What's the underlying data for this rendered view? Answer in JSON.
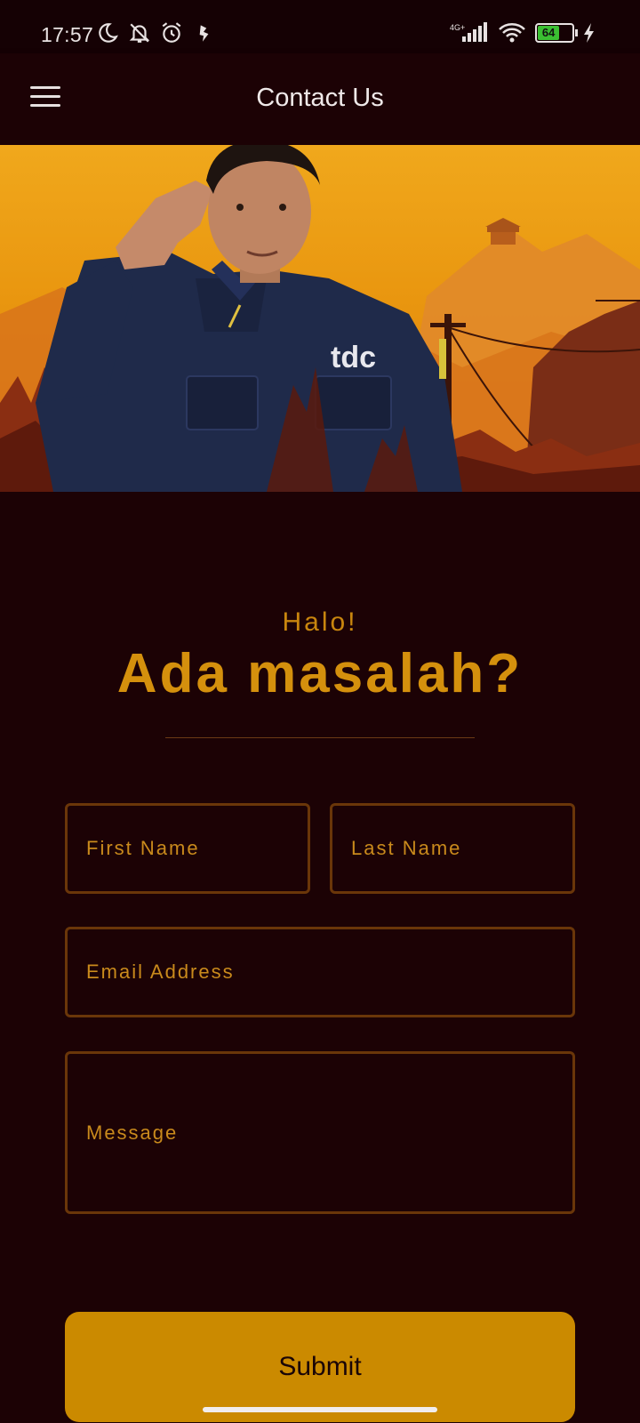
{
  "status_bar": {
    "time": "17:57",
    "network": "4G+",
    "battery_level": "64",
    "battery_color": "#3bbf32"
  },
  "app_bar": {
    "title": "Contact Us",
    "menu_icon": "hamburger-menu-icon"
  },
  "hero": {
    "shirt_logo": "tdc"
  },
  "greeting": {
    "small": "Halo!",
    "large": "Ada masalah?"
  },
  "form": {
    "first_name_placeholder": "First Name",
    "last_name_placeholder": "Last Name",
    "email_placeholder": "Email Address",
    "message_placeholder": "Message",
    "submit_label": "Submit"
  },
  "colors": {
    "background": "#1c0205",
    "accent": "#cb8a00",
    "field_border": "#6a3609",
    "text_accent": "#d4900d"
  }
}
